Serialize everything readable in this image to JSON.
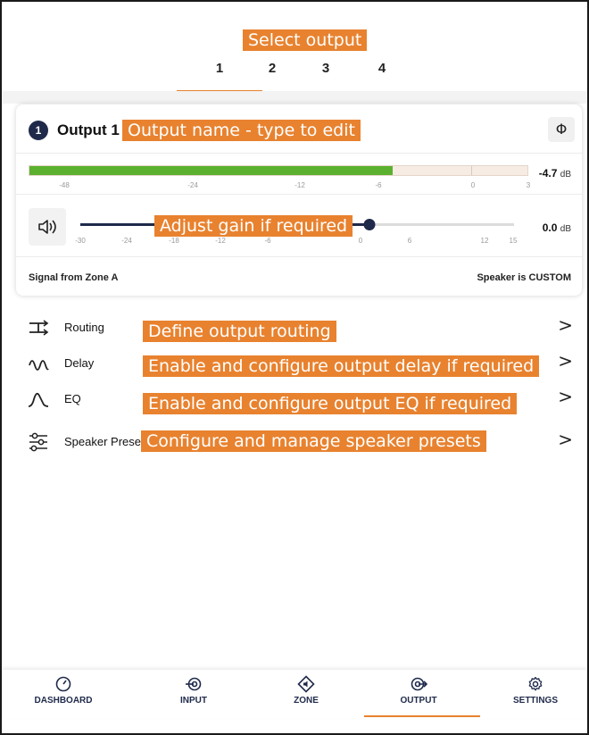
{
  "annotations": {
    "select_output": "Select output",
    "output_name": "Output name - type to edit",
    "adjust_gain": "Adjust gain if required",
    "routing": "Define output routing",
    "delay": "Enable and configure output delay if required",
    "eq": "Enable and configure output EQ if required",
    "speaker_preset": "Configure and manage speaker presets"
  },
  "tabs": [
    "1",
    "2",
    "3",
    "4"
  ],
  "active_tab": "1",
  "card": {
    "number": "1",
    "name": "Output 1",
    "phase_symbol": "Φ",
    "meter": {
      "ticks": [
        "-48",
        "-24",
        "-12",
        "-6",
        "0",
        "3"
      ],
      "level_fraction": 0.73,
      "value": "-4.7",
      "unit": "dB"
    },
    "gain": {
      "ticks": [
        "-30",
        "-24",
        "-18",
        "-12",
        "-6",
        "0",
        "6",
        "12",
        "15"
      ],
      "value_db": 0,
      "value": "0.0",
      "unit": "dB"
    },
    "signal_source": "Signal from Zone A",
    "speaker_status": "Speaker is CUSTOM"
  },
  "menu": [
    {
      "label": "Routing",
      "icon": "routing-icon"
    },
    {
      "label": "Delay",
      "icon": "delay-icon"
    },
    {
      "label": "EQ",
      "icon": "eq-curve-icon"
    },
    {
      "label": "Speaker Preset",
      "icon": "sliders-icon"
    }
  ],
  "menu_chevron": ">",
  "nav": [
    {
      "label": "DASHBOARD",
      "icon": "gauge-icon"
    },
    {
      "label": "INPUT",
      "icon": "input-icon"
    },
    {
      "label": "ZONE",
      "icon": "zone-icon"
    },
    {
      "label": "OUTPUT",
      "icon": "output-icon"
    },
    {
      "label": "SETTINGS",
      "icon": "gear-icon"
    }
  ],
  "active_nav": "OUTPUT",
  "colors": {
    "accent": "#e8822f",
    "navy": "#1f2a4a",
    "meter_green": "#5bb12f"
  }
}
